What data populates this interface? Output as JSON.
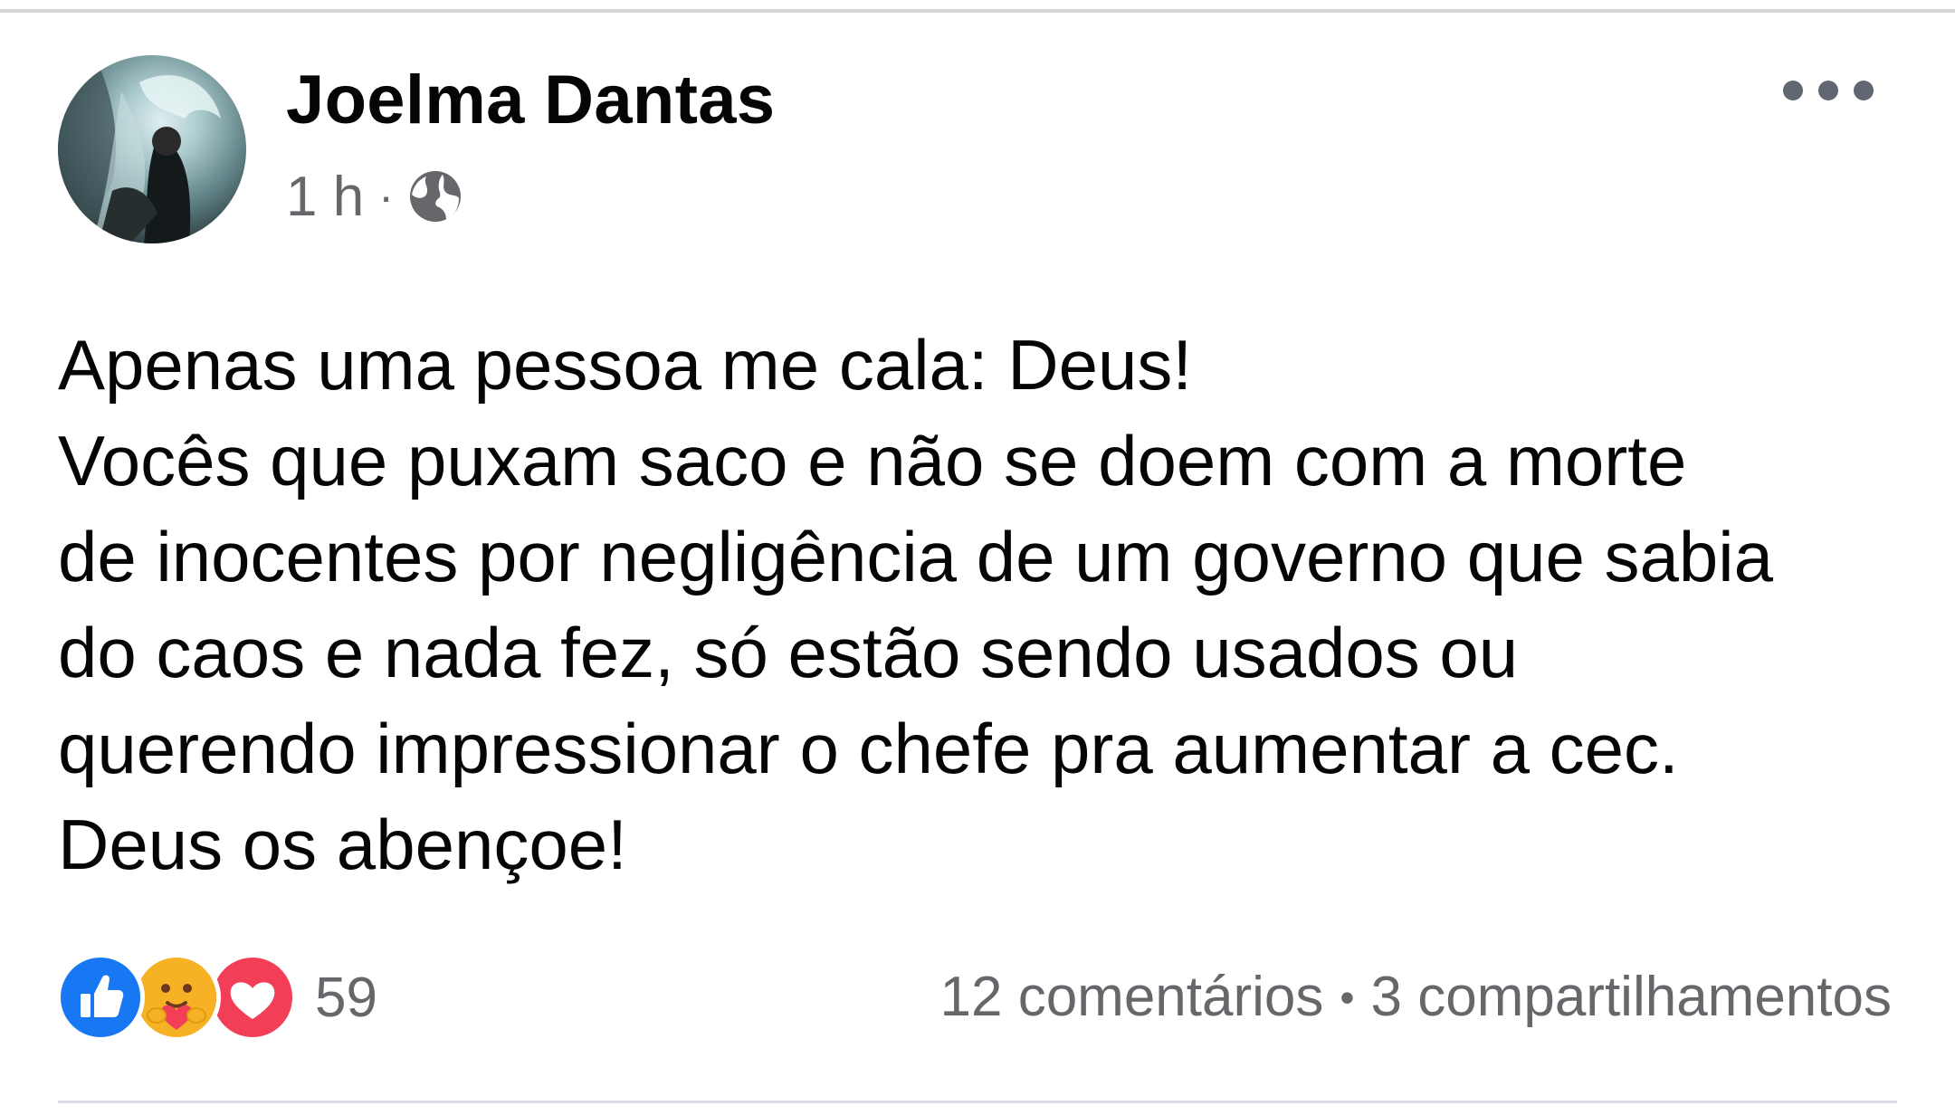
{
  "post": {
    "author": {
      "name": "Joelma Dantas"
    },
    "meta": {
      "time": "1 h",
      "separator": "·",
      "privacy_icon": "globe-icon"
    },
    "more_icon": "more-options-icon",
    "text_lines": [
      "Apenas uma pessoa me cala: Deus!",
      "Vocês que puxam saco e não se doem com a morte",
      "de inocentes por negligência de um governo que sabia",
      "do caos e nada fez, só estão sendo usados ou",
      "querendo impressionar o chefe pra aumentar a cec.",
      "Deus os abençoe!"
    ],
    "reactions": {
      "icons": [
        "like-icon",
        "care-icon",
        "love-icon"
      ],
      "count": "59"
    },
    "engagement": {
      "comments": "12 comentários",
      "separator": "•",
      "shares": "3 compartilhamentos"
    },
    "colors": {
      "like": "#1877f2",
      "love": "#f33e58",
      "care": "#f7b125",
      "secondary_text": "#65676b"
    }
  }
}
